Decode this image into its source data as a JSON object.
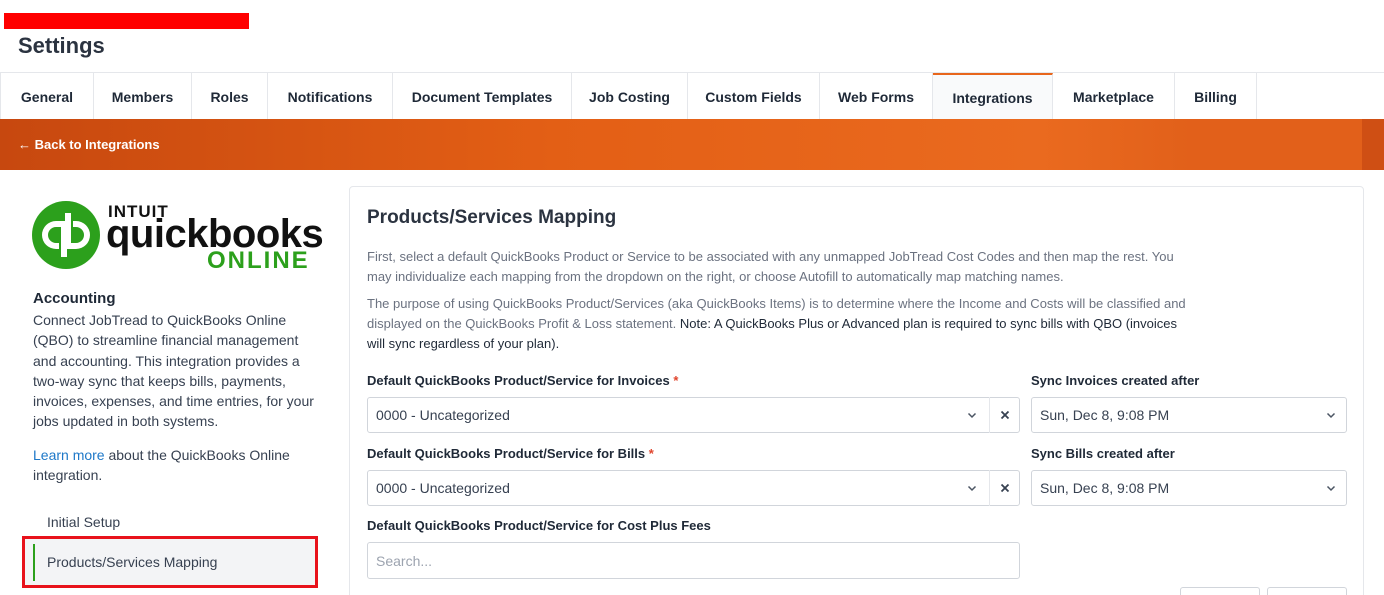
{
  "page": {
    "title": "Settings"
  },
  "tabs": [
    {
      "label": "General",
      "width": 94
    },
    {
      "label": "Members",
      "width": 98
    },
    {
      "label": "Roles",
      "width": 76
    },
    {
      "label": "Notifications",
      "width": 125
    },
    {
      "label": "Document Templates",
      "width": 179
    },
    {
      "label": "Job Costing",
      "width": 116
    },
    {
      "label": "Custom Fields",
      "width": 132
    },
    {
      "label": "Web Forms",
      "width": 113
    },
    {
      "label": "Integrations",
      "width": 120,
      "active": true
    },
    {
      "label": "Marketplace",
      "width": 122
    },
    {
      "label": "Billing",
      "width": 82
    }
  ],
  "banner": {
    "back_label": "← Back to Integrations"
  },
  "logo": {
    "intuit": "INTUIT",
    "word": "quickbooks",
    "online": "ONLINE"
  },
  "accounting": {
    "title": "Accounting",
    "description": "Connect JobTread to QuickBooks Online (QBO) to streamline financial management and accounting. This integration provides a two-way sync that keeps bills, payments, invoices, expenses, and time entries, for your jobs updated in both systems.",
    "learn_more_link": "Learn more",
    "learn_more_rest": " about the QuickBooks Online integration."
  },
  "side_nav": {
    "initial_setup": "Initial Setup",
    "products_mapping": "Products/Services Mapping"
  },
  "card": {
    "title": "Products/Services Mapping",
    "para1": "First, select a default QuickBooks Product or Service to be associated with any unmapped JobTread Cost Codes and then map the rest. You may individualize each mapping from the dropdown on the right, or choose Autofill to automatically map matching names.",
    "para2": "The purpose of using QuickBooks Product/Services (aka QuickBooks Items) is to determine where the Income and Costs will be classified and displayed on the QuickBooks Profit & Loss statement. ",
    "para2_note": "Note: A QuickBooks Plus or Advanced plan is required to sync bills with QBO (invoices will sync regardless of your plan)."
  },
  "fields": {
    "invoices_label": "Default QuickBooks Product/Service for Invoices",
    "invoices_value": "0000 - Uncategorized",
    "sync_invoices_label": "Sync Invoices created after",
    "sync_invoices_value": "Sun, Dec 8, 9:08 PM",
    "bills_label": "Default QuickBooks Product/Service for Bills",
    "bills_value": "0000 - Uncategorized",
    "sync_bills_label": "Sync Bills created after",
    "sync_bills_value": "Sun, Dec 8, 9:08 PM",
    "costplus_label": "Default QuickBooks Product/Service for Cost Plus Fees",
    "costplus_placeholder": "Search...",
    "required_mark": "*"
  },
  "colors": {
    "accent": "#e8661c",
    "qb_green": "#2ca01c",
    "link": "#1e78c8",
    "highlight": "#e8121b"
  },
  "icons": {
    "back": "arrow-left-icon",
    "chevron": "chevron-down-icon",
    "clear": "close-icon"
  }
}
